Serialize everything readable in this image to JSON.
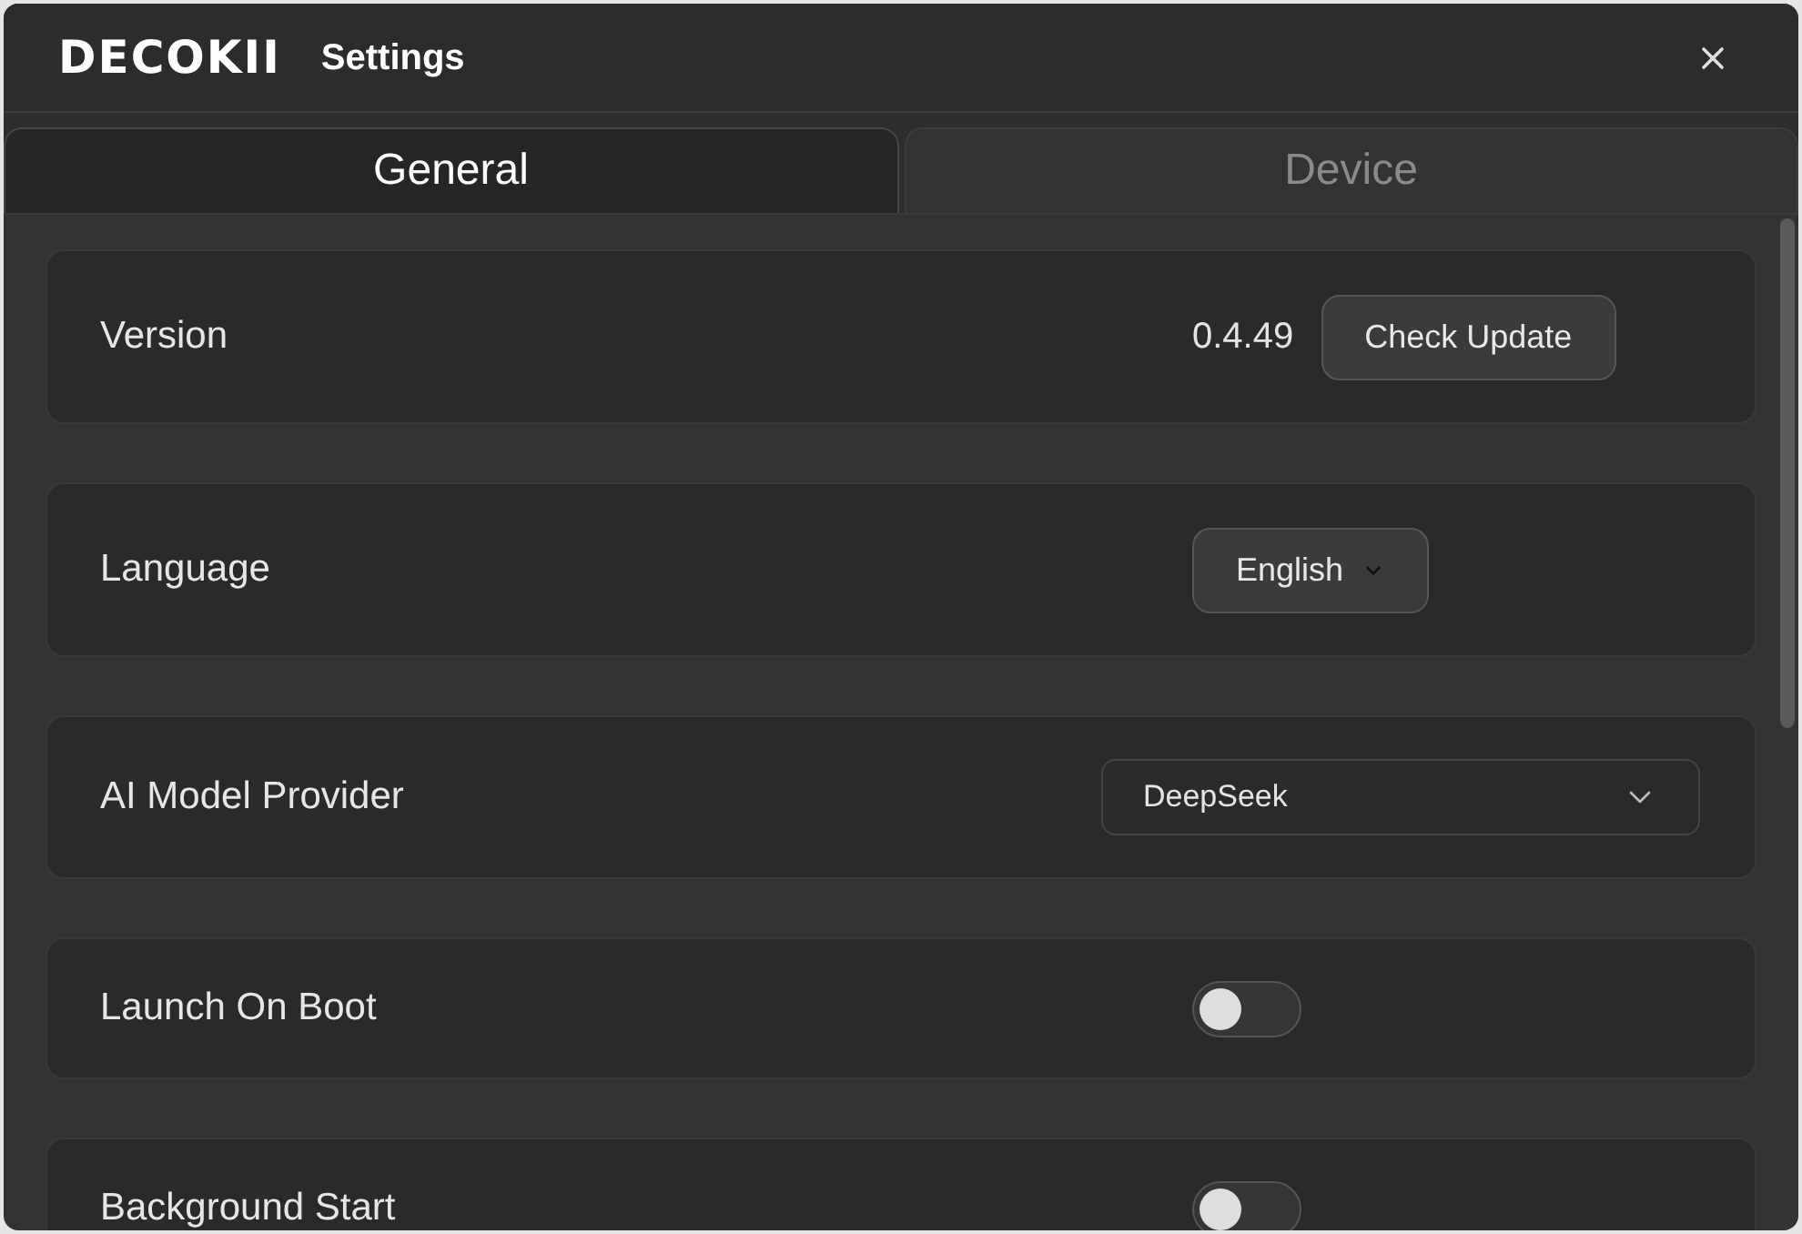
{
  "window": {
    "logo": "DECOKII",
    "title": "Settings"
  },
  "tabs": [
    {
      "label": "General",
      "selected": true
    },
    {
      "label": "Device",
      "selected": false
    }
  ],
  "rows": [
    {
      "kind": "value_button",
      "label": "Version",
      "value": "0.4.49",
      "button": "Check Update"
    },
    {
      "kind": "menu_button",
      "label": "Language",
      "value": "English"
    },
    {
      "kind": "select",
      "label": "AI Model Provider",
      "value": "DeepSeek"
    },
    {
      "kind": "toggle",
      "label": "Launch On Boot",
      "on": false
    },
    {
      "kind": "toggle",
      "label": "Background Start",
      "on": false
    }
  ]
}
